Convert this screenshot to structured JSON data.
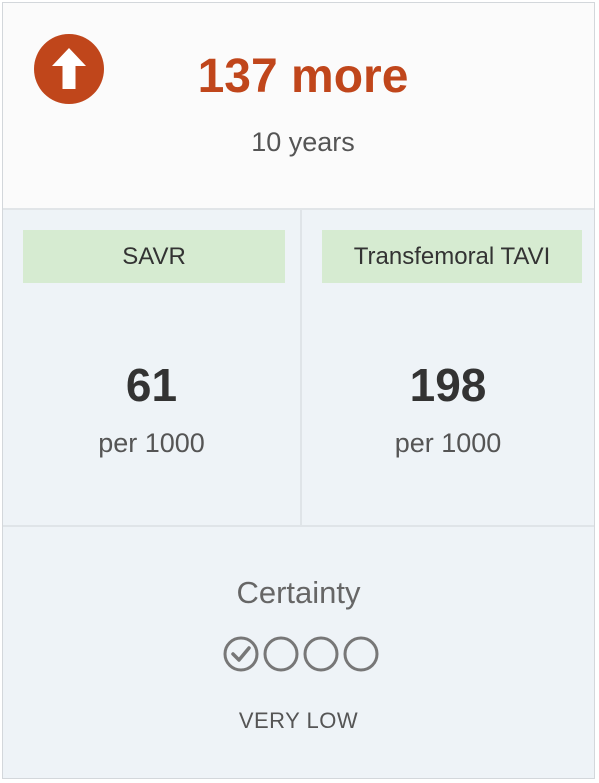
{
  "header": {
    "headline": "137 more",
    "period": "10 years",
    "icon": "arrow-up-circle-icon",
    "accent_color": "#c0461b"
  },
  "comparison": {
    "arms": [
      {
        "label": "SAVR",
        "value": "61",
        "unit": "per 1000"
      },
      {
        "label": "Transfemoral TAVI",
        "value": "198",
        "unit": "per 1000"
      }
    ],
    "label_bg_color": "#d6ebd1"
  },
  "certainty": {
    "title": "Certainty",
    "level": "VERY LOW",
    "filled_circles": 1,
    "total_circles": 4,
    "icon_color": "#777777"
  }
}
